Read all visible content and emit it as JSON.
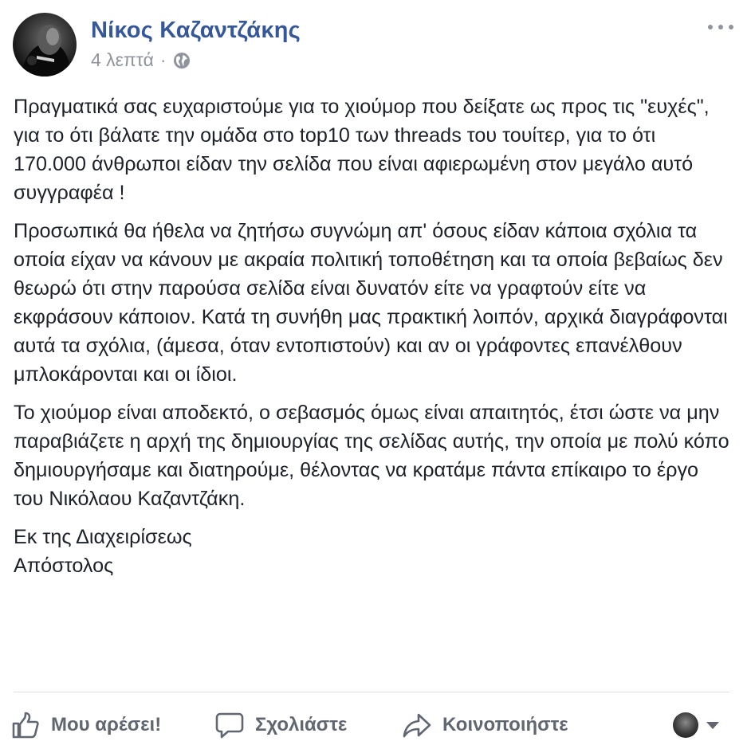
{
  "post": {
    "author": "Νίκος Καζαντζάκης",
    "time": "4 λεπτά",
    "separator": "·",
    "privacy_icon": "globe-icon",
    "menu_icon": "more-icon",
    "paragraphs": [
      "Πραγματικά σας ευχαριστούμε για το χιούμορ που δείξατε ως προς τις \"ευχές\", για το ότι βάλατε την ομάδα στο top10 των threads του τουίτερ, για το ότι 170.000 άνθρωποι είδαν την σελίδα που είναι αφιερωμένη στον μεγάλο αυτό συγγραφέα !",
      "Προσωπικά θα ήθελα να ζητήσω συγνώμη απ' όσους είδαν κάποια σχόλια τα οποία είχαν να κάνουν με ακραία πολιτική τοποθέτηση και τα οποία βεβαίως δεν θεωρώ ότι στην παρούσα σελίδα είναι δυνατόν είτε να γραφτούν είτε να εκφράσουν κάποιον. Κατά τη συνήθη μας πρακτική λοιπόν, αρχικά διαγράφονται αυτά τα σχόλια, (άμεσα, όταν εντοπιστούν) και αν οι γράφοντες επανέλθουν μπλοκάρονται και οι ίδιοι.",
      "Το χιούμορ είναι αποδεκτό, ο σεβασμός όμως είναι απαιτητός, έτσι ώστε να μην παραβιάζετε η αρχή της δημιουργίας της σελίδας αυτής, την οποία με πολύ κόπο δημιουργήσαμε και διατηρούμε, θέλοντας να κρατάμε πάντα επίκαιρο το έργο του Νικόλαου Καζαντζάκη."
    ],
    "signature_line1": "Εκ της Διαχειρίσεως",
    "signature_line2": "Απόστολος"
  },
  "actions": {
    "like_label": "Μου αρέσει!",
    "comment_label": "Σχολιάστε",
    "share_label": "Κοινοποιήστε",
    "like_icon": "thumbs-up-icon",
    "comment_icon": "comment-bubble-icon",
    "share_icon": "share-arrow-icon",
    "viewer_icon": "chevron-down-icon"
  },
  "colors": {
    "author": "#365899",
    "meta": "#90949c",
    "text": "#1d2129",
    "action": "#606770",
    "divider": "#dadde1"
  }
}
